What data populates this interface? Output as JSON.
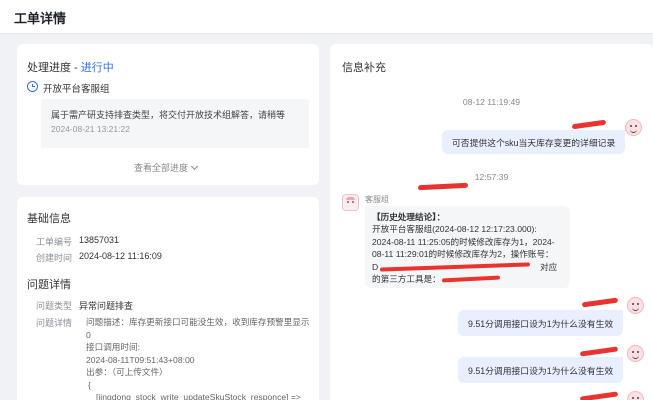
{
  "page": {
    "title": "工单详情"
  },
  "progress": {
    "label": "处理进度 - ",
    "status": "进行中",
    "step_name": "开放平台客服组",
    "step_desc": "属于需产研支持排查类型，将交付开放技术组解答，请稍等",
    "step_time": "2024-08-21 13:21:22",
    "view_all": "查看全部进度"
  },
  "basic": {
    "title": "基础信息",
    "fields": [
      {
        "label": "工单编号",
        "value": "13857031"
      },
      {
        "label": "创建时间",
        "value": "2024-08-12 11:16:09"
      }
    ]
  },
  "detail": {
    "title": "问题详情",
    "type_label": "问题类型",
    "type_value": "异常问题排查",
    "detail_label": "问题详情",
    "lines": [
      "问题描述：库存更新接口可能没生效，收到库存预警里显示",
      "0",
      "接口调用时间:",
      "2024-08-11T09:51:43+08:00",
      "出参：（可上传文件）",
      "{",
      "[jingdong_stock_write_updateSkuStock_responce] =>"
    ]
  },
  "chat": {
    "title": "信息补充",
    "ts1": "08-12 11:19:49",
    "msg1": "可否提供这个sku当天库存变更的详细记录",
    "ts2": "12:57:39",
    "agent_name": "客服组",
    "reply": {
      "heading": "【历史处理结论】：",
      "lines": [
        "开放平台客服组(2024-08-12 12:17:23.000):",
        "2024-08-11 11:25:05的时候修改库存为1，2024-",
        "08-11 11:29:01的时候修改库存为2，操作账号：",
        "D",
        "的第三方工具是："
      ],
      "tail_suffix": "对应"
    },
    "msg2": "9.51分调用接口设为1为什么没有生效",
    "msg3": "9.51分调用接口设为1为什么没有生效"
  },
  "colors": {
    "accent": "#2f6fed",
    "redaction": "#e8332f",
    "bubble_out": "#e8efff"
  }
}
